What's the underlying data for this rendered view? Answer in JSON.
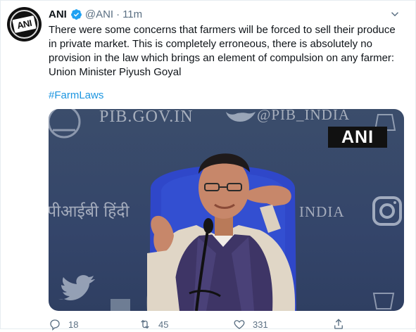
{
  "author": {
    "name": "ANI",
    "handle": "@ANI",
    "time": "11m",
    "avatar_text": "ANI"
  },
  "tweet": {
    "text": "There were some concerns that farmers will be forced to sell their produce in private market. This is completely erroneous, there is absolutely no provision in the law which brings an element of compulsion on any farmer: Union Minister Piyush Goyal",
    "hashtag": "#FarmLaws"
  },
  "media": {
    "watermark_pib": "PIB.GOV.IN",
    "watermark_handle": "@PIB_INDIA",
    "watermark_hindi": "पीआईबी हिंदी",
    "watermark_india": "INDIA",
    "badge": "ANI"
  },
  "actions": {
    "reply_count": "18",
    "retweet_count": "45",
    "like_count": "331"
  },
  "colors": {
    "accent": "#1b95e0",
    "verified": "#1da1f2",
    "muted": "#5b7083"
  }
}
